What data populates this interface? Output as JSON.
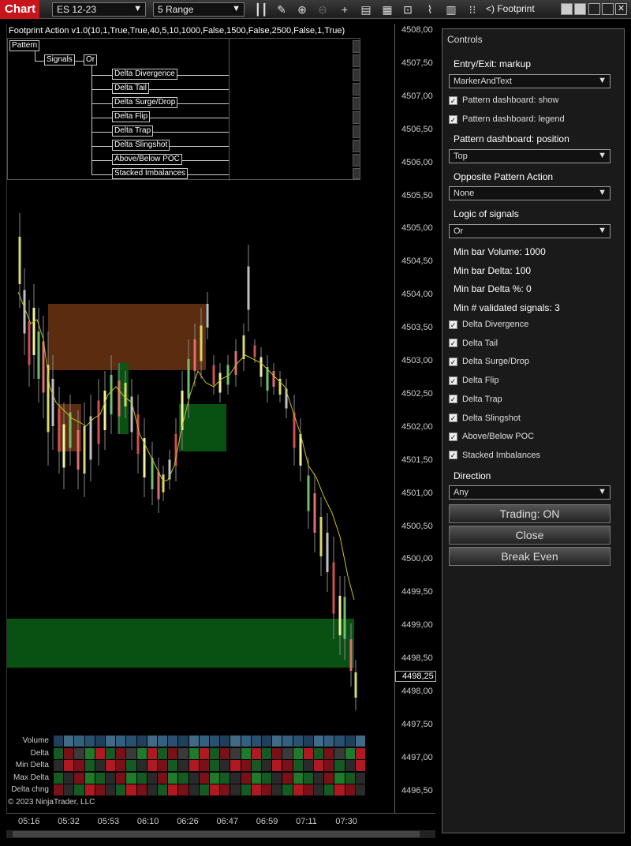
{
  "toolbar": {
    "chart_tab": "Chart",
    "instrument": "ES 12-23",
    "interval": "5 Range",
    "window_title": "<)  Footprint"
  },
  "indicator": {
    "title": "Footprint Action v1.0(10,1,True,True,40,5,10,1000,False,1500,False,2500,False,1,True)"
  },
  "pattern_tree": {
    "root": "Pattern",
    "signals": "Signals",
    "logic": "Or",
    "items": [
      "Delta Divergence",
      "Delta Tail",
      "Delta Surge/Drop",
      "Delta Flip",
      "Delta Trap",
      "Delta Slingshot",
      "Above/Below POC",
      "Stacked Imbalances"
    ]
  },
  "price_axis": {
    "labels": [
      "4508,00",
      "4507,50",
      "4507,00",
      "4506,50",
      "4506,00",
      "4505,50",
      "4505,00",
      "4504,50",
      "4504,00",
      "4503,50",
      "4503,00",
      "4502,50",
      "4502,00",
      "4501,50",
      "4501,00",
      "4500,50",
      "4500,00",
      "4499,50",
      "4499,00",
      "4498,50",
      "4498,00",
      "4497,50",
      "4497,00",
      "4496,50"
    ],
    "current": "4498,25"
  },
  "time_axis": [
    "05:16",
    "05:32",
    "05:53",
    "06:10",
    "06:26",
    "06:47",
    "06:59",
    "07:11",
    "07:30"
  ],
  "stats": {
    "labels": [
      "Volume",
      "Delta",
      "Min Delta",
      "Max Delta",
      "Delta chng"
    ]
  },
  "copyright": "© 2023 NinjaTrader, LLC",
  "controls": {
    "header": "Controls",
    "entry_exit_label": "Entry/Exit: markup",
    "entry_exit_value": "MarkerAndText",
    "dash_show": "Pattern dashboard: show",
    "dash_legend": "Pattern dashboard: legend",
    "dash_position_label": "Pattern dashboard: position",
    "dash_position_value": "Top",
    "opposite_label": "Opposite Pattern Action",
    "opposite_value": "None",
    "logic_label": "Logic of signals",
    "logic_value": "Or",
    "min_volume": "Min bar Volume: 1000",
    "min_delta": "Min bar Delta: 100",
    "min_delta_pct": "Min bar Delta %: 0",
    "min_validated": "Min # validated signals: 3",
    "signals": [
      "Delta Divergence",
      "Delta Tail",
      "Delta Surge/Drop",
      "Delta Flip",
      "Delta Trap",
      "Delta Slingshot",
      "Above/Below POC",
      "Stacked Imbalances"
    ],
    "direction_label": "Direction",
    "direction_value": "Any",
    "trading_btn": "Trading: ON",
    "close_btn": "Close",
    "breakeven_btn": "Break Even"
  }
}
